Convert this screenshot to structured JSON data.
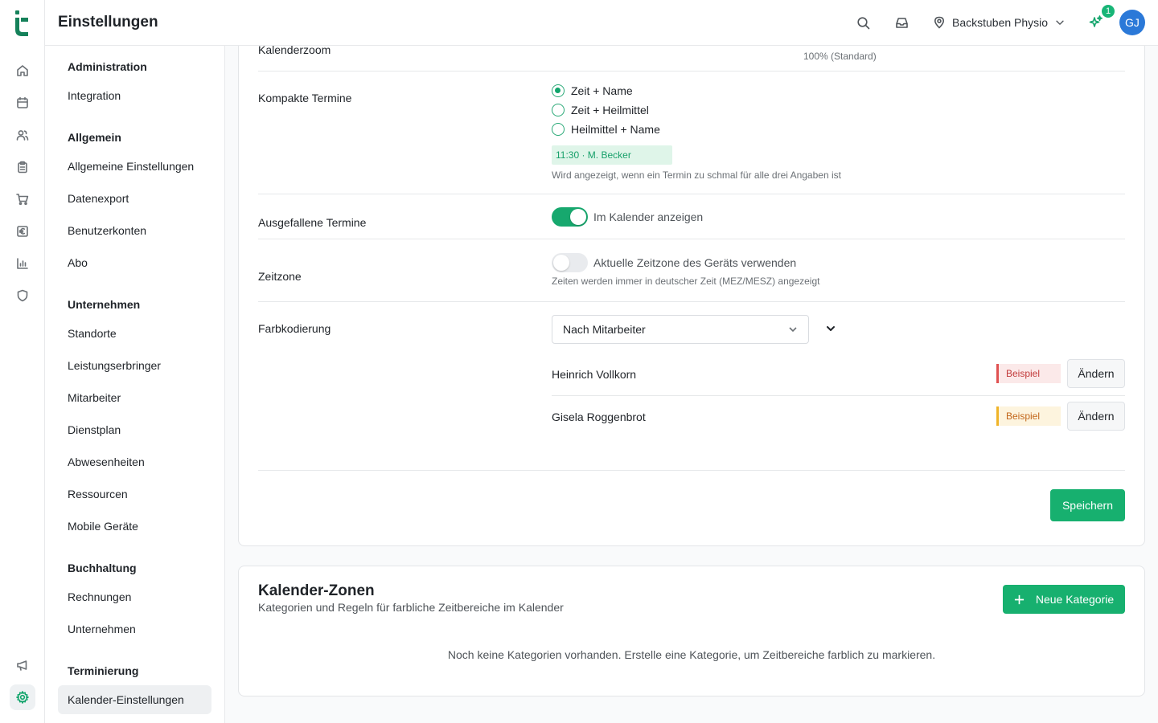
{
  "app": {
    "page_title": "Einstellungen"
  },
  "topbar": {
    "location": "Backstuben Physio",
    "notification_count": "1",
    "avatar_initials": "GJ"
  },
  "rail": {
    "icons": [
      "home-icon",
      "calendar-icon",
      "users-icon",
      "clipboard-icon",
      "cart-icon",
      "euro-icon",
      "chart-icon",
      "shield-icon",
      "megaphone-icon",
      "gear-icon"
    ]
  },
  "settings_nav": {
    "groups": [
      {
        "title": "Administration",
        "items": [
          "Integration"
        ]
      },
      {
        "title": "Allgemein",
        "items": [
          "Allgemeine Einstellungen",
          "Datenexport",
          "Benutzerkonten",
          "Abo"
        ]
      },
      {
        "title": "Unternehmen",
        "items": [
          "Standorte",
          "Leistungserbringer",
          "Mitarbeiter",
          "Dienstplan",
          "Abwesenheiten",
          "Ressourcen",
          "Mobile Geräte"
        ]
      },
      {
        "title": "Buchhaltung",
        "items": [
          "Rechnungen",
          "Unternehmen"
        ]
      },
      {
        "title": "Terminierung",
        "items": [
          "Kalender-Einstellungen"
        ]
      }
    ],
    "active_item": "Kalender-Einstellungen"
  },
  "calendar_settings": {
    "zoom": {
      "label": "Kalenderzoom",
      "value_text": "100% (Standard)"
    },
    "compact": {
      "label": "Kompakte Termine",
      "options": [
        "Zeit + Name",
        "Zeit + Heilmittel",
        "Heilmittel + Name"
      ],
      "selected": "Zeit + Name",
      "preview": "11:30 · M. Becker",
      "hint": "Wird angezeigt, wenn ein Termin zu schmal für alle drei Angaben ist"
    },
    "cancelled": {
      "label": "Ausgefallene Termine",
      "toggle_label": "Im Kalender anzeigen",
      "enabled": true
    },
    "timezone": {
      "label": "Zeitzone",
      "toggle_label": "Aktuelle Zeitzone des Geräts verwenden",
      "enabled": false,
      "hint": "Zeiten werden immer in deutscher Zeit (MEZ/MESZ) angezeigt"
    },
    "color_coding": {
      "label": "Farbkodierung",
      "selected": "Nach Mitarbeiter",
      "employees": [
        {
          "name": "Heinrich Vollkorn",
          "sample": "Beispiel",
          "color": "#e05252",
          "button": "Ändern"
        },
        {
          "name": "Gisela Roggenbrot",
          "sample": "Beispiel",
          "color": "#f0b429",
          "button": "Ändern"
        }
      ]
    },
    "save_label": "Speichern"
  },
  "zones": {
    "title": "Kalender-Zonen",
    "subtitle": "Kategorien und Regeln für farbliche Zeitbereiche im Kalender",
    "new_button": "Neue Kategorie",
    "empty_text": "Noch keine Kategorien vorhanden. Erstelle eine Kategorie, um Zeitbereiche farblich zu markieren."
  },
  "colors": {
    "accent": "#17b06f",
    "avatar": "#2b79d8"
  }
}
